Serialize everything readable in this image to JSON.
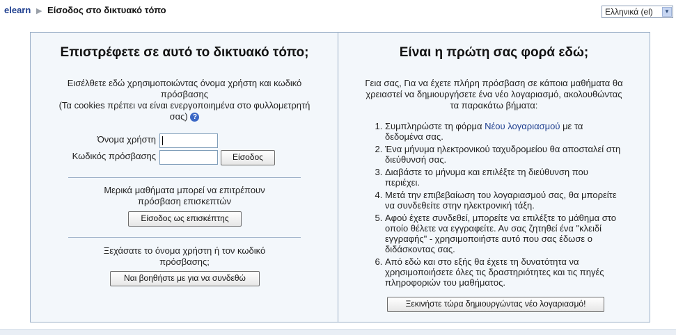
{
  "breadcrumb": {
    "home": "elearn",
    "separator": "▶",
    "current": "Είσοδος στο δικτυακό τόπο"
  },
  "language": {
    "selected": "Ελληνικά (el)"
  },
  "login": {
    "heading": "Επιστρέφετε σε αυτό το δικτυακό τόπο;",
    "intro_line1": "Εισέλθετε εδώ χρησιμοποιώντας όνομα χρήστη και κωδικό",
    "intro_line2": "πρόσβασης",
    "intro_line3": "(Τα cookies πρέπει να είναι ενεργοποιημένα στο φυλλομετρητή",
    "intro_line4": "σας)",
    "username_label": "Όνομα χρήστη",
    "password_label": "Κωδικός πρόσβασης",
    "login_button": "Είσοδος",
    "guest_text_line1": "Μερικά μαθήματα μπορεί να επιτρέπουν",
    "guest_text_line2": "πρόσβαση επισκεπτών",
    "guest_button": "Είσοδος ως επισκέπτης",
    "forgot_text_line1": "Ξεχάσατε το όνομα χρήστη ή τον κωδικό",
    "forgot_text_line2": "πρόσβασης;",
    "forgot_button": "Ναι βοηθήστε με για να συνδεθώ"
  },
  "signup": {
    "heading": "Είναι η πρώτη σας φορά εδώ;",
    "intro_line1": "Γεια σας, Για να έχετε πλήρη πρόσβαση σε κάποια μαθήματα θα",
    "intro_line2": "χρειαστεί να δημιουργήσετε ένα νέο λογαριασμό, ακολουθώντας",
    "intro_line3": "τα παρακάτω βήματα:",
    "step1_before": "Συμπληρώστε τη φόρμα ",
    "step1_link": "Νέου λογαριασμού",
    "step1_after": " με τα δεδομένα σας.",
    "step2": "Ένα μήνυμα ηλεκτρονικού ταχυδρομείου θα αποσταλεί στη διεύθυνσή σας.",
    "step3": "Διαβάστε το μήνυμα και επιλέξτε τη διεύθυνση που περιέχει.",
    "step4": "Μετά την επιβεβαίωση του λογαριασμού σας, θα μπορείτε να συνδεθείτε στην ηλεκτρονική τάξη.",
    "step5": "Αφού έχετε συνδεθεί, μπορείτε να επιλέξτε το μάθημα στο οποίο θέλετε να εγγραφείτε. Αν σας ζητηθεί ένα \"κλειδί εγγραφής\" - χρησιμοποιήστε αυτό που σας έδωσε ο διδάσκοντας σας.",
    "step6": "Από εδώ και στο εξής θα έχετε τη δυνατότητα να χρησιμοποιήσετε όλες τις δραστηριότητες και τις πηγές πληροφοριών του μαθήματος.",
    "create_button": "Ξεκινήστε τώρα δημιουργώντας νέο λογαριασμό!"
  }
}
